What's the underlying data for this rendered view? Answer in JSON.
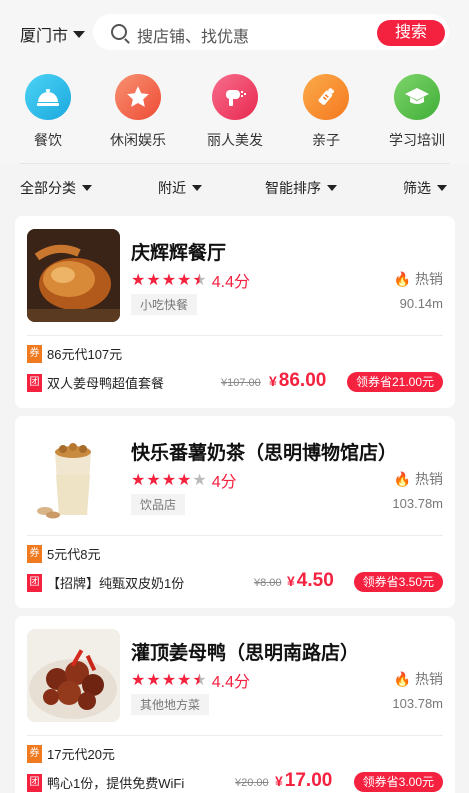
{
  "header": {
    "city": "厦门市",
    "search_placeholder": "搜店铺、找优惠",
    "search_button": "搜索"
  },
  "categories": [
    {
      "label": "餐饮",
      "icon": "dining-icon",
      "color": "#27b9e8"
    },
    {
      "label": "休闲娱乐",
      "icon": "star-icon",
      "color": "#f2684a"
    },
    {
      "label": "丽人美发",
      "icon": "hairdryer-icon",
      "color": "#f04364"
    },
    {
      "label": "亲子",
      "icon": "baby-bottle-icon",
      "color": "#f98d29"
    },
    {
      "label": "学习培训",
      "icon": "graduation-cap-icon",
      "color": "#5dc14b"
    }
  ],
  "filters": [
    "全部分类",
    "附近",
    "智能排序",
    "筛选"
  ],
  "shops": [
    {
      "name": "庆辉辉餐厅",
      "rating": 4.4,
      "score": "4.4分",
      "hot": "热销",
      "tag": "小吃快餐",
      "distance": "90.14m",
      "voucher": "86元代107元",
      "deal": "双人姜母鸭超值套餐",
      "orig_price": "¥107.00",
      "currency": "¥",
      "price": "86.00",
      "coupon": "领券省21.00元"
    },
    {
      "name": "快乐番薯奶茶（思明博物馆店）",
      "rating": 4.0,
      "score": "4分",
      "hot": "热销",
      "tag": "饮品店",
      "distance": "103.78m",
      "voucher": "5元代8元",
      "deal": "【招牌】纯甄双皮奶1份",
      "orig_price": "¥8.00",
      "currency": "¥",
      "price": "4.50",
      "coupon": "领券省3.50元"
    },
    {
      "name": "灌顶姜母鸭（思明南路店）",
      "rating": 4.4,
      "score": "4.4分",
      "hot": "热销",
      "tag": "其他地方菜",
      "distance": "103.78m",
      "voucher": "17元代20元",
      "deal": "鸭心1份，提供免费WiFi",
      "orig_price": "¥20.00",
      "currency": "¥",
      "price": "17.00",
      "coupon": "领券省3.00元"
    }
  ],
  "badges": {
    "voucher": "券",
    "group": "团"
  },
  "colors": {
    "accent": "#f4213f",
    "voucher_badge": "#f07a1f"
  }
}
